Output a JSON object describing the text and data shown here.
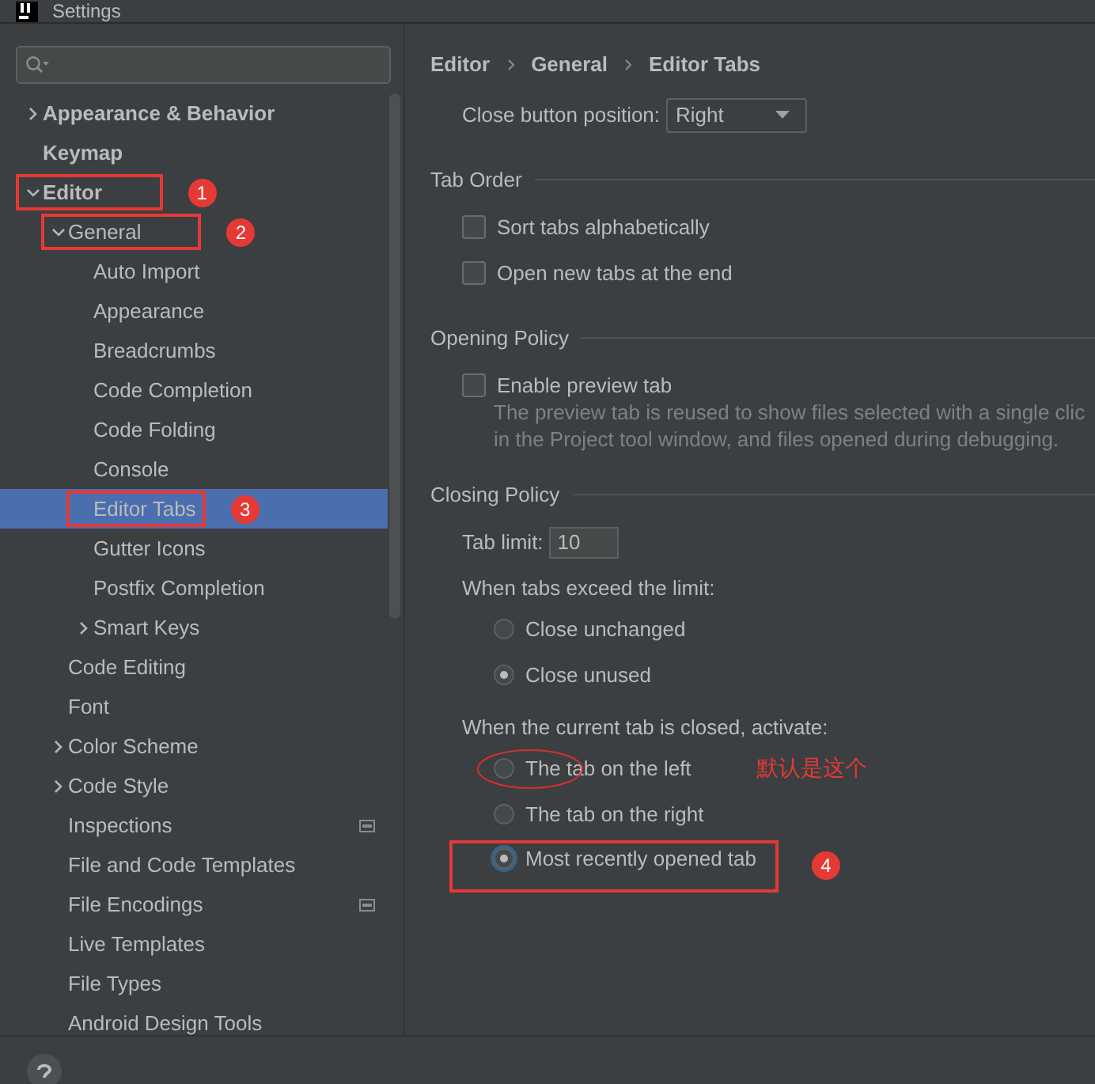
{
  "window": {
    "title": "Settings"
  },
  "tree": [
    {
      "label": "Appearance & Behavior",
      "expanded": false,
      "selected": false,
      "scoped": false
    },
    {
      "label": "Keymap",
      "selected": false,
      "scoped": false
    },
    {
      "label": "Editor",
      "expanded": true,
      "selected": false,
      "scoped": false,
      "annotation": "1",
      "children": [
        {
          "label": "General",
          "expanded": true,
          "selected": false,
          "scoped": false,
          "annotation": "2",
          "children": [
            {
              "label": "Auto Import",
              "selected": false,
              "scoped": false
            },
            {
              "label": "Appearance",
              "selected": false,
              "scoped": false
            },
            {
              "label": "Breadcrumbs",
              "selected": false,
              "scoped": false
            },
            {
              "label": "Code Completion",
              "selected": false,
              "scoped": false
            },
            {
              "label": "Code Folding",
              "selected": false,
              "scoped": false
            },
            {
              "label": "Console",
              "selected": false,
              "scoped": false
            },
            {
              "label": "Editor Tabs",
              "selected": true,
              "scoped": false,
              "annotation": "3"
            },
            {
              "label": "Gutter Icons",
              "selected": false,
              "scoped": false
            },
            {
              "label": "Postfix Completion",
              "selected": false,
              "scoped": false
            },
            {
              "label": "Smart Keys",
              "expanded": false,
              "selected": false,
              "scoped": false
            }
          ]
        },
        {
          "label": "Code Editing",
          "selected": false,
          "scoped": false
        },
        {
          "label": "Font",
          "selected": false,
          "scoped": false
        },
        {
          "label": "Color Scheme",
          "expanded": false,
          "selected": false,
          "scoped": false
        },
        {
          "label": "Code Style",
          "expanded": false,
          "selected": false,
          "scoped": false
        },
        {
          "label": "Inspections",
          "selected": false,
          "scoped": true
        },
        {
          "label": "File and Code Templates",
          "selected": false,
          "scoped": false
        },
        {
          "label": "File Encodings",
          "selected": false,
          "scoped": true
        },
        {
          "label": "Live Templates",
          "selected": false,
          "scoped": false
        },
        {
          "label": "File Types",
          "selected": false,
          "scoped": false
        },
        {
          "label": "Android Design Tools",
          "selected": false,
          "scoped": false
        }
      ]
    }
  ],
  "breadcrumb": [
    "Editor",
    "General",
    "Editor Tabs"
  ],
  "sections": [
    {
      "items": [
        {
          "kind": "dropdown",
          "label": "Close button position:",
          "value": "Right"
        }
      ]
    },
    {
      "title": "Tab Order",
      "items": [
        {
          "kind": "checkbox",
          "label": "Sort tabs alphabetically",
          "checked": false
        },
        {
          "kind": "checkbox",
          "label": "Open new tabs at the end",
          "checked": false
        }
      ]
    },
    {
      "title": "Opening Policy",
      "items": [
        {
          "kind": "checkbox",
          "label": "Enable preview tab",
          "checked": false
        },
        {
          "kind": "hint",
          "lines": [
            "The preview tab is reused to show files selected with a single clic",
            "in the Project tool window, and files opened during debugging."
          ]
        }
      ]
    },
    {
      "title": "Closing Policy",
      "items": [
        {
          "kind": "number",
          "label": "Tab limit:",
          "value": "10"
        },
        {
          "kind": "radios",
          "label": "When tabs exceed the limit:",
          "options": [
            {
              "label": "Close unchanged",
              "selected": false,
              "focused": false,
              "circled": false
            },
            {
              "label": "Close unused",
              "selected": true,
              "focused": false,
              "circled": false
            }
          ]
        },
        {
          "kind": "radios",
          "label": "When the current tab is closed, activate:",
          "options": [
            {
              "label": "The tab on the left",
              "selected": false,
              "focused": false,
              "circled": true,
              "note": "默认是这个"
            },
            {
              "label": "The tab on the right",
              "selected": false,
              "focused": false,
              "circled": false
            },
            {
              "label": "Most recently opened tab",
              "selected": true,
              "focused": true,
              "circled": false,
              "annotation": "4"
            }
          ]
        }
      ]
    }
  ]
}
